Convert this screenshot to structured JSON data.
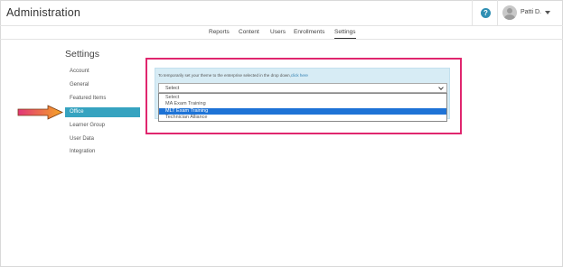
{
  "header": {
    "title": "Administration",
    "help_icon": "question-circle-icon",
    "user_name": "Patti D."
  },
  "topnav": [
    {
      "label": "Reports"
    },
    {
      "label": "Content"
    },
    {
      "label": "Users"
    },
    {
      "label": "Enrollments"
    },
    {
      "label": "Settings",
      "active": true
    }
  ],
  "sidebar": {
    "title": "Settings",
    "items": [
      {
        "label": "Account"
      },
      {
        "label": "General"
      },
      {
        "label": "Featured Items"
      },
      {
        "label": "Office",
        "active": true
      },
      {
        "label": "Learner Group"
      },
      {
        "label": "User Data"
      },
      {
        "label": "Integration"
      }
    ]
  },
  "office_panel": {
    "info_text": "To temporarily set your theme to the enterprise selected in the drop down,",
    "info_link": "click here",
    "select": {
      "value": "Select",
      "options": [
        {
          "label": "Select"
        },
        {
          "label": "MA Exam Training"
        },
        {
          "label": "MLT Exam Training",
          "highlighted": true
        },
        {
          "label": "Technician Alliance"
        }
      ]
    }
  },
  "colors": {
    "accent": "#36a3c0",
    "highlight_border": "#e0266e",
    "arrow": "#f26a3a",
    "selected_option": "#1e73d6",
    "info_background": "#d7ecf5"
  }
}
